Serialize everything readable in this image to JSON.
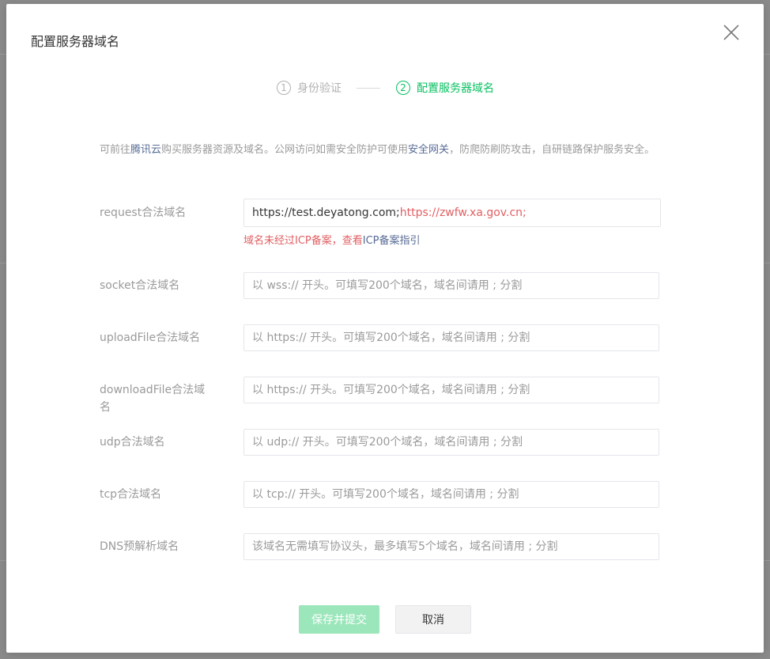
{
  "modal": {
    "title": "配置服务器域名"
  },
  "steps": [
    {
      "num": "1",
      "label": "身份验证",
      "state": "inactive"
    },
    {
      "num": "2",
      "label": "配置服务器域名",
      "state": "active"
    }
  ],
  "intro": {
    "part1": "可前往",
    "link1": "腾讯云",
    "part2": "购买服务器资源及域名。公网访问如需安全防护可使用",
    "link2": "安全网关",
    "part3": "，防爬防刷防攻击，自研链路保护服务安全。"
  },
  "fields": {
    "request": {
      "label": "request合法域名",
      "value_ok": "https://test.deyatong.com;",
      "value_bad": "https://zwfw.xa.gov.cn;",
      "error_text": "域名未经过ICP备案，查看",
      "error_link": "ICP备案指引"
    },
    "socket": {
      "label": "socket合法域名",
      "placeholder": "以 wss:// 开头。可填写200个域名，域名间请用 ; 分割"
    },
    "uploadFile": {
      "label": "uploadFile合法域名",
      "placeholder": "以 https:// 开头。可填写200个域名，域名间请用 ; 分割"
    },
    "downloadFile": {
      "label": "downloadFile合法域名",
      "placeholder": "以 https:// 开头。可填写200个域名，域名间请用 ; 分割"
    },
    "udp": {
      "label": "udp合法域名",
      "placeholder": "以 udp:// 开头。可填写200个域名，域名间请用 ; 分割"
    },
    "tcp": {
      "label": "tcp合法域名",
      "placeholder": "以 tcp:// 开头。可填写200个域名，域名间请用 ; 分割"
    },
    "dns": {
      "label": "DNS预解析域名",
      "placeholder": "该域名无需填写协议头，最多填写5个域名，域名间请用 ; 分割"
    }
  },
  "buttons": {
    "submit": "保存并提交",
    "cancel": "取消"
  },
  "colors": {
    "accent": "#07c160",
    "error": "#e15f63",
    "link": "#576b95",
    "primary_disabled": "#9be6bb"
  }
}
